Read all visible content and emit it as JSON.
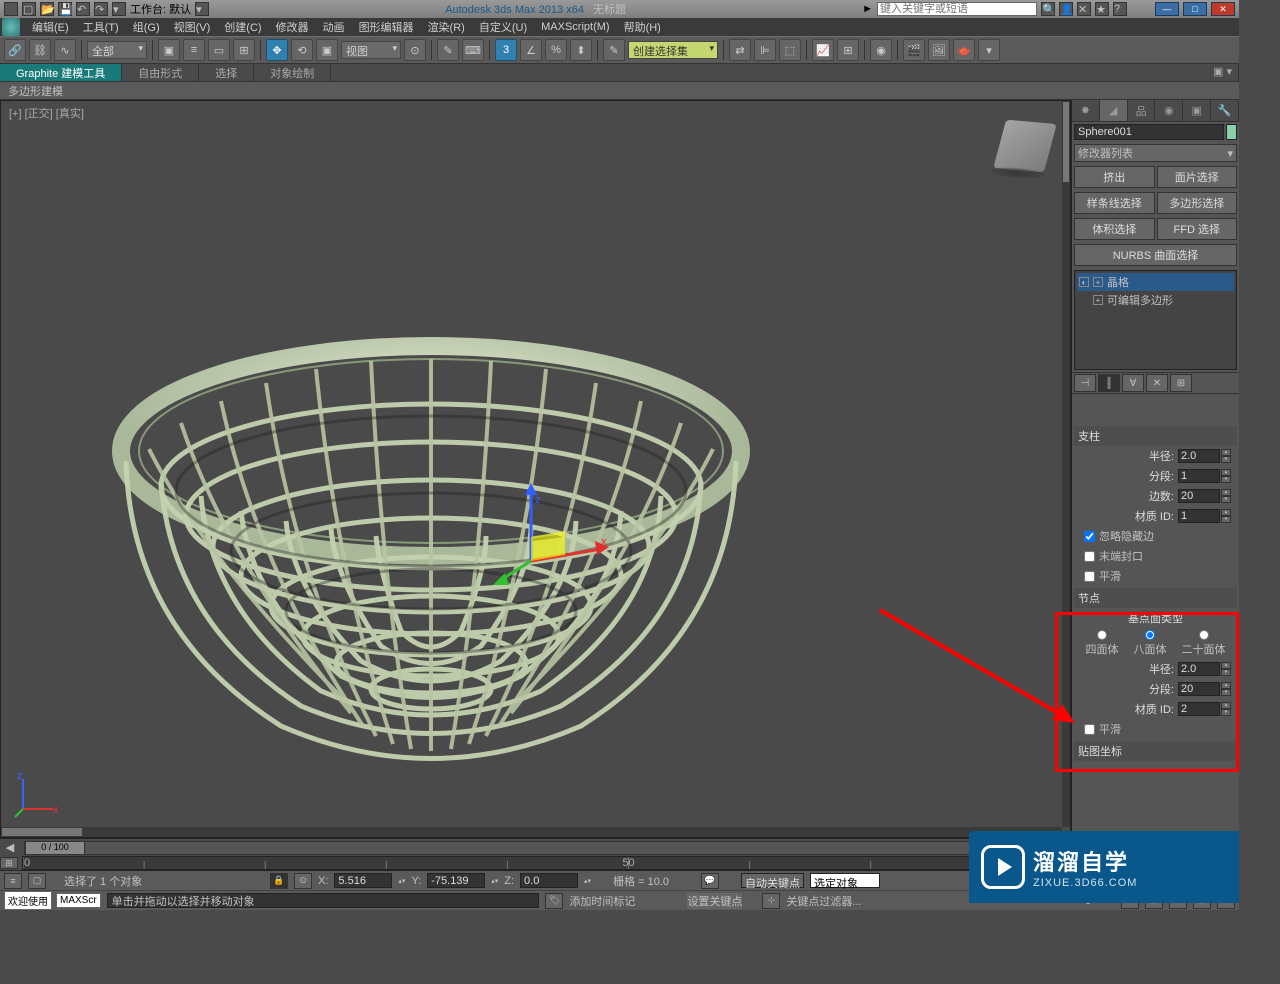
{
  "title": {
    "workspace_label": "工作台: 默认",
    "app": "Autodesk 3ds Max  2013 x64",
    "doc": "无标题",
    "search_placeholder": "键入关键字或短语"
  },
  "menu": {
    "edit": "编辑(E)",
    "tools": "工具(T)",
    "group": "组(G)",
    "views": "视图(V)",
    "create": "创建(C)",
    "modifiers": "修改器",
    "animation": "动画",
    "graph": "图形编辑器",
    "render": "渲染(R)",
    "custom": "自定义(U)",
    "maxscript": "MAXScript(M)",
    "help": "帮助(H)"
  },
  "toolbar": {
    "filter": "全部",
    "viewdd": "视图",
    "sel_set": "创建选择集"
  },
  "ribbon": {
    "t1": "Graphite 建模工具",
    "t2": "自由形式",
    "t3": "选择",
    "t4": "对象绘制",
    "sub": "多边形建模"
  },
  "viewport": {
    "label": "[+] [正交] [真实]"
  },
  "cmd": {
    "name": "Sphere001",
    "modlist": "修改器列表",
    "b1": "挤出",
    "b2": "面片选择",
    "b3": "样条线选择",
    "b4": "多边形选择",
    "b5": "体积选择",
    "b6": "FFD 选择",
    "b7": "NURBS 曲面选择",
    "stack1": "晶格",
    "stack2": "可编辑多边形",
    "r1": {
      "title": "支柱",
      "radius": "半径:",
      "radius_v": "2.0",
      "segs": "分段:",
      "segs_v": "1",
      "sides": "边数:",
      "sides_v": "20",
      "mat": "材质 ID:",
      "mat_v": "1",
      "ignore": "忽略隐藏边",
      "cap": "末端封口",
      "smooth": "平滑"
    },
    "r2": {
      "title": "节点",
      "basetype": "基点面类型",
      "tet": "四面体",
      "oct": "八面体",
      "ico": "二十面体",
      "radius": "半径:",
      "radius_v": "2.0",
      "segs": "分段:",
      "segs_v": "20",
      "mat": "材质 ID:",
      "mat_v": "2",
      "smooth": "平滑"
    },
    "r3": "贴图坐标"
  },
  "timeline": {
    "frames": "0 / 100"
  },
  "status": {
    "sel": "选择了 1 个对象",
    "x": "X:",
    "xv": "5.516",
    "y": "Y:",
    "yv": "-75.139",
    "z": "Z:",
    "zv": "0.0",
    "grid": "栅格 = 10.0",
    "autokey": "自动关键点",
    "selset": "选定对象",
    "prompt": "单击并拖动以选择并移动对象",
    "addtime": "添加时间标记",
    "setkey": "设置关键点",
    "keyfilter": "关键点过滤器...",
    "welcome": "欢迎使用",
    "mini": "MAXScr"
  },
  "logo": {
    "cn": "溜溜自学",
    "en": "ZIXUE.3D66.COM"
  }
}
